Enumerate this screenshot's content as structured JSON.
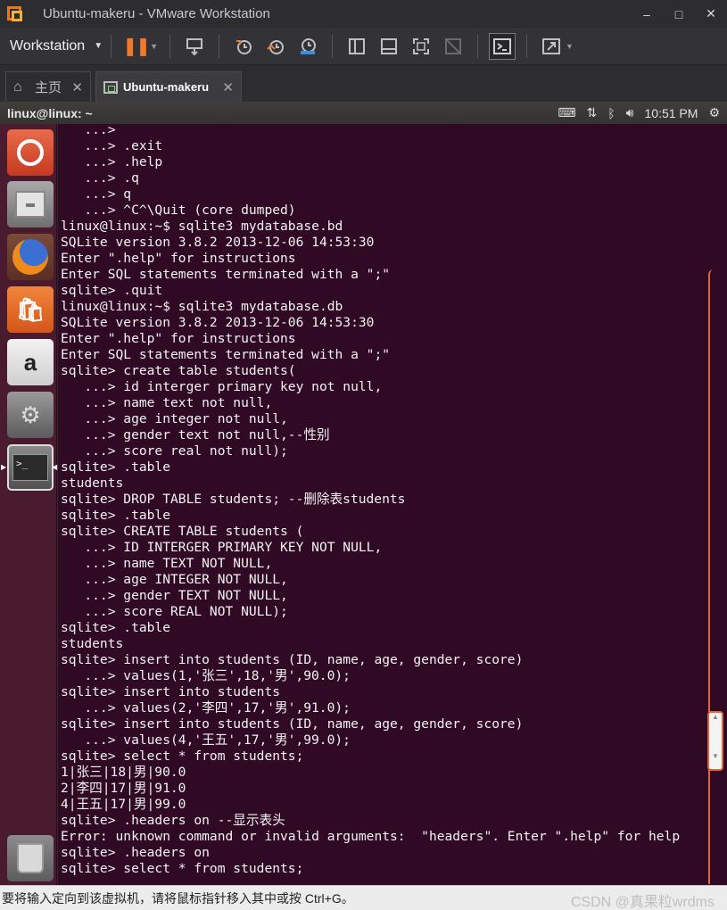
{
  "window": {
    "title": "Ubuntu-makeru - VMware Workstation",
    "minimize": "–",
    "maximize": "□",
    "close": "✕"
  },
  "toolbar": {
    "workstation_label": "Workstation",
    "icons": [
      "pause-icon",
      "send-keys-icon",
      "snapshot-icon",
      "revert-snapshot-icon",
      "snapshot-manager-icon",
      "library-icon",
      "thumbnail-icon",
      "fullscreen-icon",
      "unity-icon",
      "console-icon",
      "stretch-icon"
    ]
  },
  "tabs": [
    {
      "label": "主页"
    },
    {
      "label": "Ubuntu-makeru"
    }
  ],
  "ubuntu_panel": {
    "title": "linux@linux: ~",
    "time": "10:51 PM"
  },
  "terminal": {
    "lines": [
      "   ...>",
      "   ...> .exit",
      "   ...> .help",
      "   ...> .q",
      "   ...> q",
      "   ...> ^C^\\Quit (core dumped)",
      "linux@linux:~$ sqlite3 mydatabase.bd",
      "SQLite version 3.8.2 2013-12-06 14:53:30",
      "Enter \".help\" for instructions",
      "Enter SQL statements terminated with a \";\"",
      "sqlite> .quit",
      "linux@linux:~$ sqlite3 mydatabase.db",
      "SQLite version 3.8.2 2013-12-06 14:53:30",
      "Enter \".help\" for instructions",
      "Enter SQL statements terminated with a \";\"",
      "sqlite> create table students(",
      "   ...> id interger primary key not null,",
      "   ...> name text not null,",
      "   ...> age integer not null,",
      "   ...> gender text not null,--性别",
      "   ...> score real not null);",
      "sqlite> .table",
      "students",
      "sqlite> DROP TABLE students; --删除表students",
      "sqlite> .table",
      "sqlite> CREATE TABLE students (",
      "   ...> ID INTERGER PRIMARY KEY NOT NULL,",
      "   ...> name TEXT NOT NULL,",
      "   ...> age INTEGER NOT NULL,",
      "   ...> gender TEXT NOT NULL,",
      "   ...> score REAL NOT NULL);",
      "sqlite> .table",
      "students",
      "sqlite> insert into students (ID, name, age, gender, score)",
      "   ...> values(1,'张三',18,'男',90.0);",
      "sqlite> insert into students",
      "   ...> values(2,'李四',17,'男',91.0);",
      "sqlite> insert into students (ID, name, age, gender, score)",
      "   ...> values(4,'王五',17,'男',99.0);",
      "sqlite> select * from students;",
      "1|张三|18|男|90.0",
      "2|李四|17|男|91.0",
      "4|王五|17|男|99.0",
      "sqlite> .headers on --显示表头",
      "Error: unknown command or invalid arguments:  \"headers\". Enter \".help\" for help",
      "sqlite> .headers on",
      "sqlite> select * from students;"
    ]
  },
  "statusbar": {
    "text": "要将输入定向到该虚拟机，请将鼠标指针移入其中或按 Ctrl+G。",
    "watermark": "CSDN @真果粒wrdms"
  }
}
